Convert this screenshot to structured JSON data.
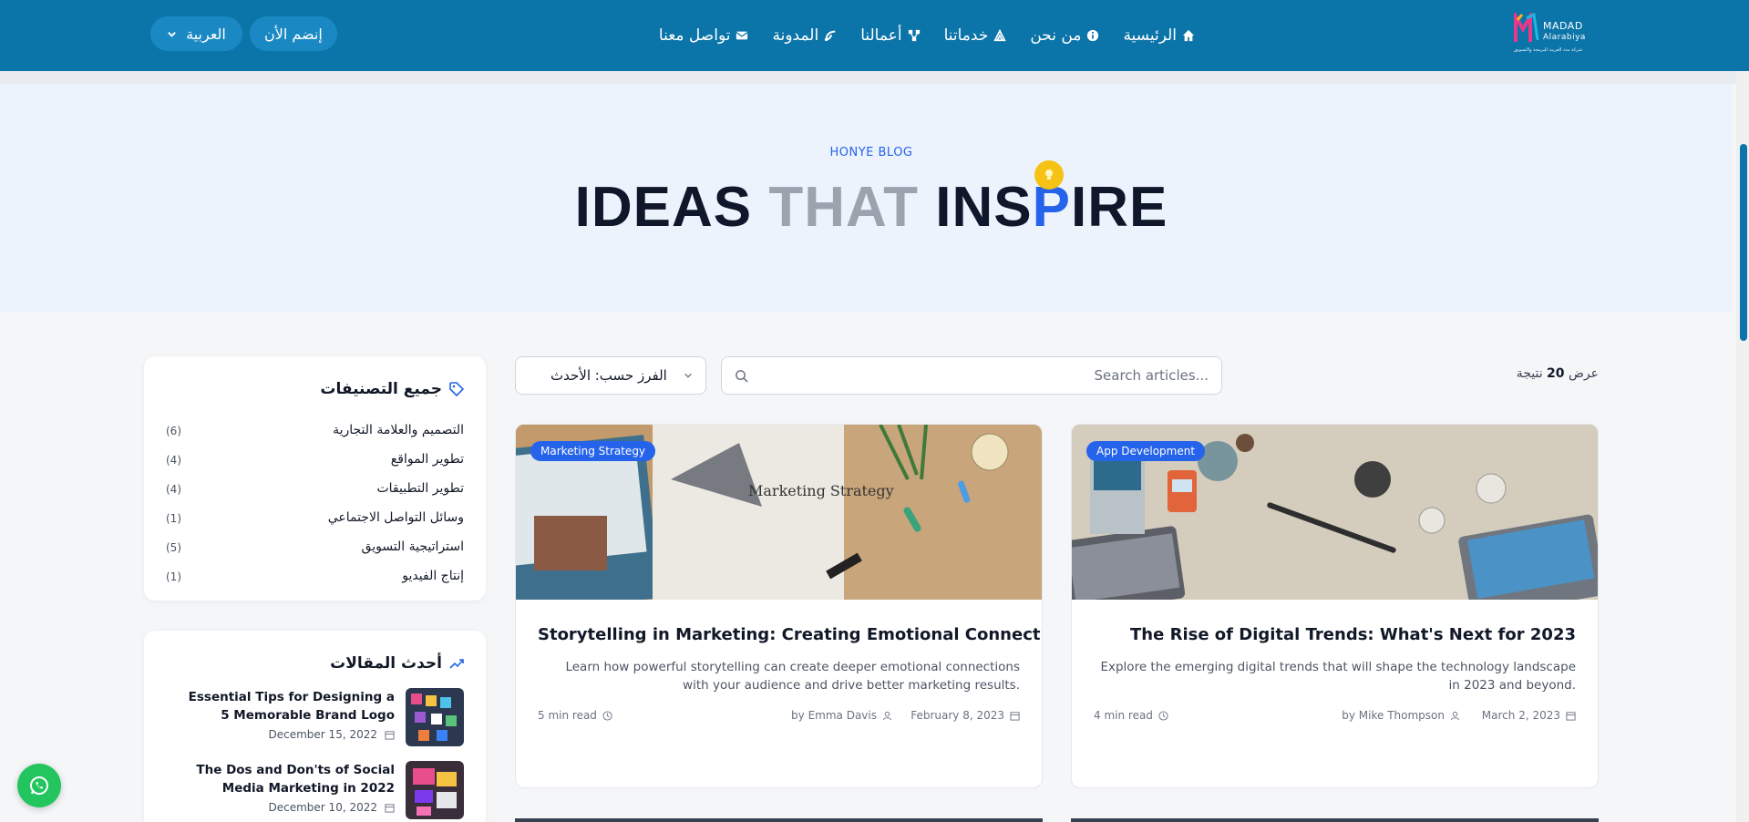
{
  "header": {
    "logo": {
      "brand_line1": "MADAD",
      "brand_line2": "Alarabiya",
      "tagline": "شركة مدد العربية للبرمجة والتسويق"
    },
    "nav": [
      {
        "label": "الرئيسية",
        "icon": "home-icon"
      },
      {
        "label": "من نحن",
        "icon": "info-icon"
      },
      {
        "label": "خدماتنا",
        "icon": "services-icon"
      },
      {
        "label": "أعمالنا",
        "icon": "portfolio-icon"
      },
      {
        "label": "المدونة",
        "icon": "blog-icon"
      },
      {
        "label": "تواصل معنا",
        "icon": "envelope-icon"
      }
    ],
    "join_label": "إنضم الأن",
    "language_label": "العربية"
  },
  "hero": {
    "kicker": "HONYE BLOG",
    "title_word1": "IDEAS",
    "title_word2": "THAT",
    "title_word3_a": "INS",
    "title_word3_b": "P",
    "title_word3_c": "IRE"
  },
  "toolbar": {
    "result_prefix": "عرض",
    "result_count": "20",
    "result_suffix": "نتيجة",
    "search_placeholder": "Search articles...",
    "sort_label": "الفرز حسب: الأحدث"
  },
  "articles": [
    {
      "tag": "App Development",
      "title": "The Rise of Digital Trends: What's Next for 2023",
      "description": "Explore the emerging digital trends that will shape the technology landscape in 2023 and beyond.",
      "date": "March 2, 2023",
      "author": "by Mike Thompson",
      "read_time": "4 min read"
    },
    {
      "tag": "Marketing Strategy",
      "title": "Storytelling in Marketing: Creating Emotional Connections",
      "description": "Learn how powerful storytelling can create deeper emotional connections with your audience and drive better marketing results.",
      "date": "February 8, 2023",
      "author": "by Emma Davis",
      "read_time": "5 min read",
      "image_text": "Marketing Strategy"
    }
  ],
  "sidebar": {
    "categories_title": "جميع التصنيفات",
    "categories": [
      {
        "name": "التصميم والعلامة التجارية",
        "count": "(6)"
      },
      {
        "name": "تطوير المواقع",
        "count": "(4)"
      },
      {
        "name": "تطوير التطبيقات",
        "count": "(4)"
      },
      {
        "name": "وسائل التواصل الاجتماعي",
        "count": "(1)"
      },
      {
        "name": "استراتيجية التسويق",
        "count": "(5)"
      },
      {
        "name": "إنتاج الفيديو",
        "count": "(1)"
      }
    ],
    "recent_title": "أحدث المقالات",
    "recent_posts": [
      {
        "title": "Essential Tips for Designing a 5 Memorable Brand Logo",
        "date": "December 15, 2022"
      },
      {
        "title": "The Dos and Don'ts of Social Media Marketing in 2022",
        "date": "December 10, 2022"
      }
    ]
  },
  "colors": {
    "nav_bg": "#0b74a8",
    "accent": "#2563eb",
    "hero_bg": "#edf3fd",
    "whatsapp": "#22c55e",
    "bulb": "#f6c213"
  }
}
